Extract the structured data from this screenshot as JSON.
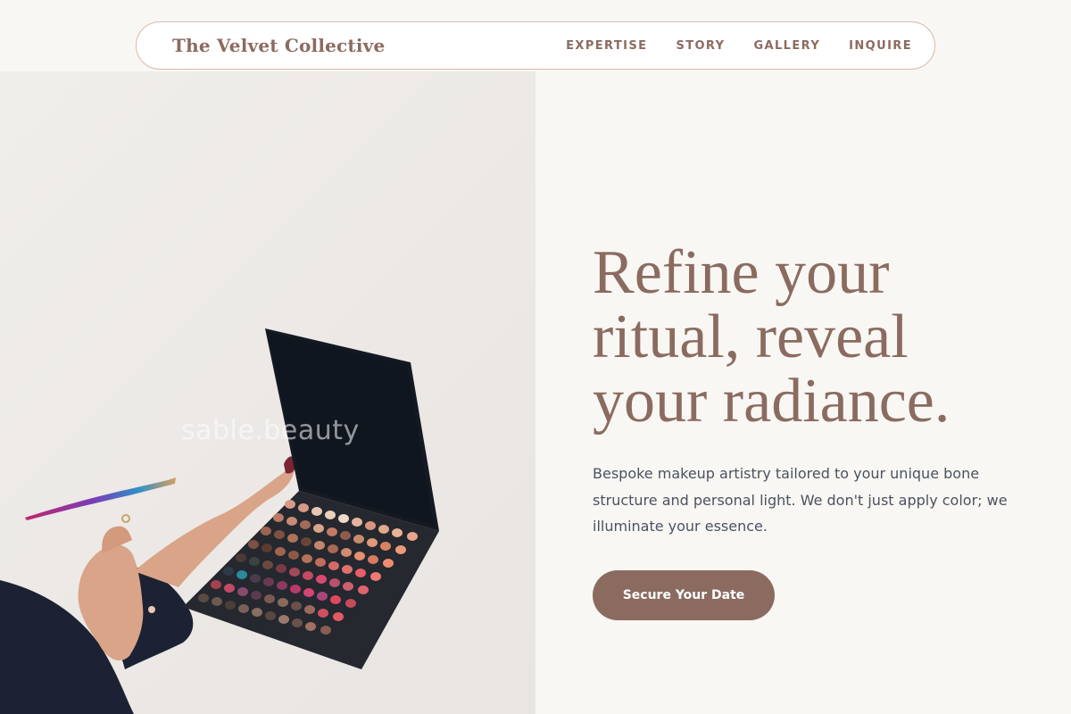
{
  "nav": {
    "brand": "The Velvet Collective",
    "links": [
      {
        "label": "EXPERTISE"
      },
      {
        "label": "STORY"
      },
      {
        "label": "GALLERY"
      },
      {
        "label": "INQUIRE"
      }
    ]
  },
  "hero": {
    "headline_lines": [
      "Refine your",
      "ritual, reveal",
      "your radiance."
    ],
    "description": "Bespoke makeup artistry tailored to your unique bone structure and personal light. We don't just apply color; we illuminate your essence.",
    "cta_label": "Secure Your Date",
    "image_watermark": "sable.beauty"
  },
  "colors": {
    "accent": "#8b6b60",
    "nav_border": "#d9b8aa",
    "page_bg": "#f9f7f3",
    "body_text": "#4a5260"
  }
}
